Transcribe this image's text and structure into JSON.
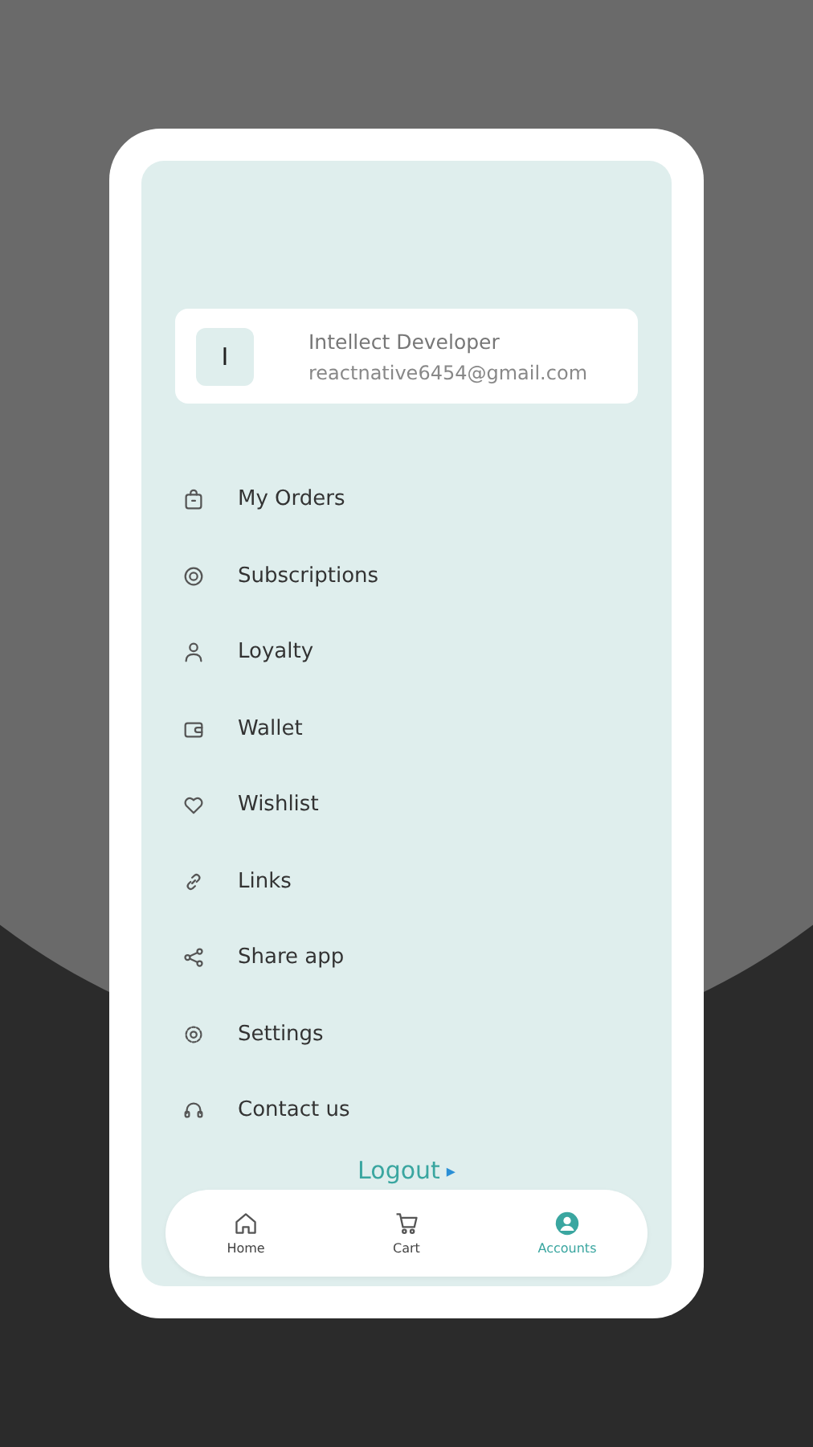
{
  "profile": {
    "avatar_letter": "I",
    "name": "Intellect Developer",
    "email": "reactnative6454@gmail.com"
  },
  "menu": [
    {
      "label": "My Orders"
    },
    {
      "label": "Subscriptions"
    },
    {
      "label": "Loyalty"
    },
    {
      "label": "Wallet"
    },
    {
      "label": "Wishlist"
    },
    {
      "label": "Links"
    },
    {
      "label": "Share app"
    },
    {
      "label": "Settings"
    },
    {
      "label": "Contact us"
    }
  ],
  "logout": {
    "label": "Logout",
    "arrow": "▸"
  },
  "nav": [
    {
      "label": "Home",
      "selected": false
    },
    {
      "label": "Cart",
      "selected": false
    },
    {
      "label": "Accounts",
      "selected": true
    }
  ]
}
